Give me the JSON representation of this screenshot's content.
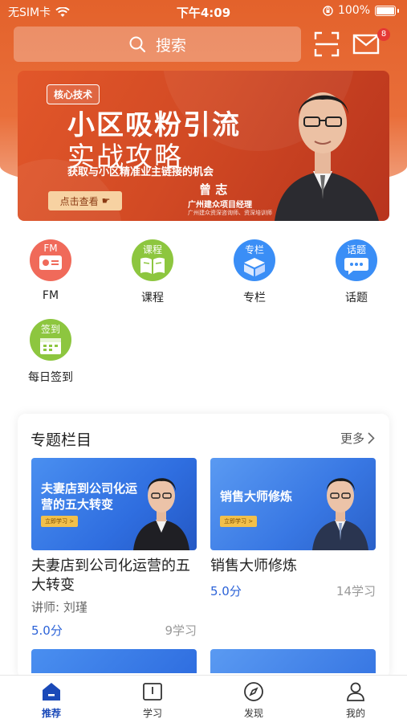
{
  "status_bar": {
    "carrier": "无SIM卡",
    "time": "下午4:09",
    "battery": "100%"
  },
  "header": {
    "search_placeholder": "搜索",
    "mail_badge": "8",
    "icons": [
      "search-icon",
      "scan-icon",
      "mail-icon"
    ]
  },
  "banner": {
    "tag": "核心技术",
    "title": "小区吸粉引流",
    "subtitle": "实战攻略",
    "desc": "获取与小区精准业主链接的机会",
    "button": "点击查看",
    "speaker_name": "曾 志",
    "speaker_role": "广州建众项目经理",
    "speaker_role2": "广州建众资深咨询师、资深培训师"
  },
  "categories": [
    {
      "label": "FM",
      "icon_text": "FM",
      "icon": "fm-icon",
      "color": "#f06a5a"
    },
    {
      "label": "课程",
      "icon_text": "课程",
      "icon": "book-icon",
      "color": "#8dc63f"
    },
    {
      "label": "专栏",
      "icon_text": "专栏",
      "icon": "cube-icon",
      "color": "#3a8ef6"
    },
    {
      "label": "话题",
      "icon_text": "话题",
      "icon": "chat-icon",
      "color": "#3a8ef6"
    },
    {
      "label": "每日签到",
      "icon_text": "签到",
      "icon": "calendar-icon",
      "color": "#8dc63f"
    }
  ],
  "section": {
    "title": "专题栏目",
    "more": "更多"
  },
  "courses": [
    {
      "thumb_title": "夫妻店到公司化运营的五大转变",
      "thumb_button": "立即学习 >",
      "name": "夫妻店到公司化运营的五大转变",
      "teacher": "讲师: 刘瑾",
      "score": "5.0分",
      "learners": "9学习"
    },
    {
      "thumb_title": "销售大师修炼",
      "thumb_button": "立即学习 >",
      "name": "销售大师修炼",
      "teacher": "",
      "score": "5.0分",
      "learners": "14学习"
    }
  ],
  "tabbar": [
    {
      "label": "推荐",
      "icon": "home-icon",
      "active": true
    },
    {
      "label": "学习",
      "icon": "book-open-icon",
      "active": false
    },
    {
      "label": "发现",
      "icon": "compass-icon",
      "active": false
    },
    {
      "label": "我的",
      "icon": "user-icon",
      "active": false
    }
  ],
  "colors": {
    "accent_orange": "#e3622b",
    "brand_blue": "#1a49b8",
    "score_blue": "#2c63d8"
  }
}
